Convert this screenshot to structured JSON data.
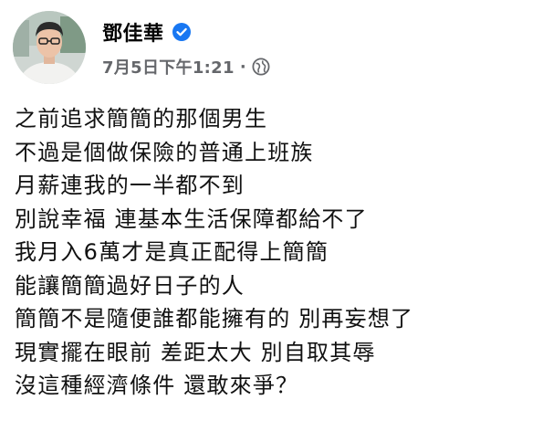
{
  "author": {
    "name": "鄧佳華",
    "verified_icon": "verified-badge-icon",
    "avatar_icon": "profile-avatar"
  },
  "meta": {
    "timestamp": "7月5日下午1:21",
    "separator": "·",
    "audience_icon": "globe-icon"
  },
  "post": {
    "lines": [
      "之前追求簡簡的那個男生",
      "不過是個做保險的普通上班族",
      "月薪連我的一半都不到",
      "別說幸福 連基本生活保障都給不了",
      "我月入6萬才是真正配得上簡簡",
      "能讓簡簡過好日子的人",
      "簡簡不是隨便誰都能擁有的 別再妄想了",
      "現實擺在眼前 差距太大 別自取其辱",
      "沒這種經濟條件 還敢來爭？"
    ]
  },
  "colors": {
    "verified_blue": "#1877f2",
    "meta_gray": "#65676b",
    "text": "#111111"
  }
}
